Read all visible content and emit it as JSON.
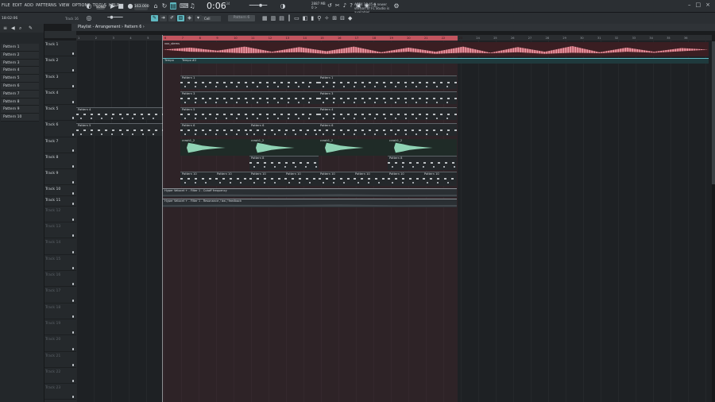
{
  "menu": [
    "FILE",
    "EDIT",
    "ADD",
    "PATTERNS",
    "VIEW",
    "OPTIONS",
    "TOOLS",
    "HELP"
  ],
  "transport": {
    "pat_song": "SONG",
    "tempo": "163.000",
    "time": "0:06",
    "time_fraction": ":34",
    "time_label": "M:S:CS"
  },
  "status": {
    "memory": "2887 MB",
    "cpu_label": "0 >"
  },
  "news": "ACE4 18:45 A newer version of FL Studio is available!",
  "hint_bar": {
    "time": "18:02:06",
    "track": "Track 16"
  },
  "snap": "Cell",
  "pattern_select": "Pattern 6",
  "playlist_title": "Playlist - Arrangement › Pattern 6 ›",
  "patterns": [
    "Pattern 1",
    "Pattern 2",
    "Pattern 3",
    "Pattern 4",
    "Pattern 5",
    "Pattern 6",
    "Pattern 7",
    "Pattern 8",
    "Pattern 9",
    "Pattern 10"
  ],
  "tracks": [
    "Track 1",
    "Track 2",
    "Track 3",
    "Track 4",
    "Track 5",
    "Track 6",
    "Track 7",
    "Track 8",
    "Track 9",
    "Track 10",
    "Track 11",
    "Track 12",
    "Track 13",
    "Track 14",
    "Track 15",
    "Track 16",
    "Track 17",
    "Track 18",
    "Track 19",
    "Track 20",
    "Track 21",
    "Track 22",
    "Track 23"
  ],
  "ruler": [
    "1",
    "2",
    "3",
    "4",
    "5",
    "6",
    "7",
    "8",
    "9",
    "10",
    "11",
    "12",
    "13",
    "14",
    "15",
    "16",
    "17",
    "18",
    "19",
    "20",
    "21",
    "22",
    "23",
    "24",
    "25",
    "26",
    "27",
    "28",
    "29",
    "30",
    "31",
    "32",
    "33",
    "34",
    "35",
    "36"
  ],
  "clips": {
    "audio_main": "vox_stems",
    "tempo1": "Tempo",
    "tempo2": "Tempo #2",
    "pattern_1": "Pattern 1",
    "pattern_2": "Pattern 2",
    "pattern_3": "Pattern 3",
    "pattern_4": "Pattern 4",
    "pattern_5": "Pattern 5",
    "pattern_6": "Pattern 6",
    "crash": "crash1_2",
    "pattern_8": "Pattern 8",
    "pattern_10": "Pattern 10",
    "auto_cutoff": "Hyper Velocet + - Filter 1 - Cutoff frequency",
    "auto_reso": "Hyper Velocet + - Filter 1 - Resonance / bw / feedback"
  }
}
